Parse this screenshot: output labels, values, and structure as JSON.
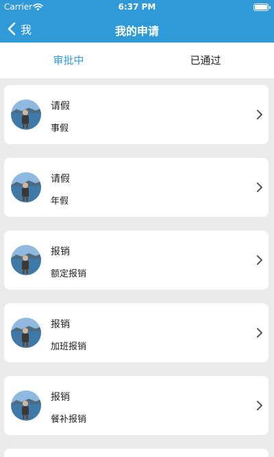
{
  "status_bar": {
    "carrier": "Carrier",
    "time": "6:37 PM"
  },
  "nav": {
    "back_label": "我",
    "title": "我的申请"
  },
  "tabs": [
    {
      "label": "审批中",
      "active": true
    },
    {
      "label": "已通过",
      "active": false
    }
  ],
  "items": [
    {
      "title": "请假",
      "subtitle": "事假"
    },
    {
      "title": "请假",
      "subtitle": "年假"
    },
    {
      "title": "报销",
      "subtitle": "额定报销"
    },
    {
      "title": "报销",
      "subtitle": "加班报销"
    },
    {
      "title": "报销",
      "subtitle": "餐补报销"
    }
  ],
  "colors": {
    "accent": "#2f9ad7",
    "background": "#ebebeb"
  }
}
